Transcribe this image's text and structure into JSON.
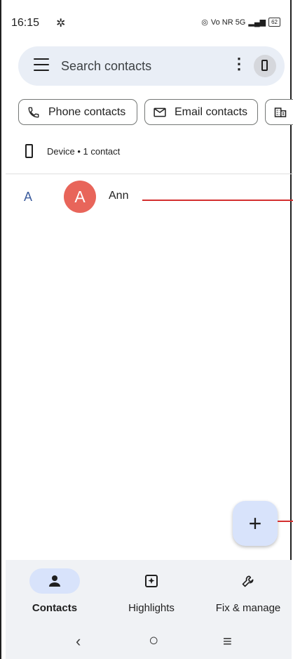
{
  "status": {
    "time": "16:15",
    "signal_text": "Vo NR 5G",
    "battery": "62"
  },
  "search": {
    "placeholder": "Search contacts"
  },
  "chips": [
    {
      "label": "Phone contacts",
      "icon": "phone-icon"
    },
    {
      "label": "Email contacts",
      "icon": "email-icon"
    },
    {
      "label": "",
      "icon": "building-icon"
    }
  ],
  "account_section": {
    "label": "Device • 1 contact"
  },
  "contacts": [
    {
      "index_letter": "A",
      "initial": "A",
      "name": "Ann",
      "avatar_color": "#e8655a"
    }
  ],
  "fab": {
    "icon": "plus-icon",
    "label": "+"
  },
  "bottom_nav": [
    {
      "label": "Contacts",
      "icon": "person-icon",
      "active": true
    },
    {
      "label": "Highlights",
      "icon": "highlights-icon",
      "active": false
    },
    {
      "label": "Fix & manage",
      "icon": "wrench-icon",
      "active": false
    }
  ],
  "system_nav": {
    "back": "‹",
    "home": "○",
    "recents": "≡"
  },
  "colors": {
    "accent_bg": "#d8e3fb",
    "search_bg": "#e9eef6",
    "annotation_red": "#d32f2f"
  }
}
